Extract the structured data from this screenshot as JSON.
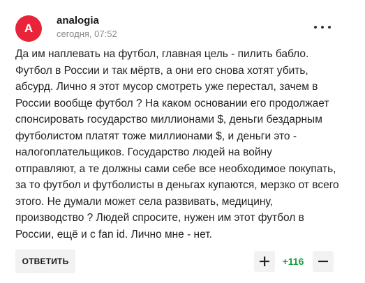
{
  "comment": {
    "avatar_letter": "A",
    "avatar_color": "#e8243a",
    "username": "analogia",
    "timestamp": "сегодня, 07:52",
    "text": "Да им наплевать на футбол, главная цель - пилить бабло.\nФутбол в России и так мёртв, а они его снова хотят убить,\nабсурд. Лично я этот мусор смотреть уже перестал, зачем в\nРоссии вообще футбол ? На каком основании его продолжает\nспонсировать государство миллионами $, деньги бездарным\nфутболистом платят тоже миллионами $, и деньги это -\nналогоплательщиков. Государство людей на войну\nотправляют, а те должны сами себе все необходимое покупать,\nза то футбол и футболисты в деньгах купаются, мерзко от всего\nэтого. Не думали может села развивать, медицину,\nпроизводство ? Людей спросите, нужен им этот футбол в\nРоссии, ещё и с fan id. Лично мне - нет."
  },
  "actions": {
    "reply_label": "ОТВЕТИТЬ",
    "upvote_icon": "plus-icon",
    "downvote_icon": "minus-icon",
    "vote_count": "+116",
    "vote_count_color": "#1b9e3e"
  },
  "menu": {
    "icon": "more-horizontal-icon"
  }
}
